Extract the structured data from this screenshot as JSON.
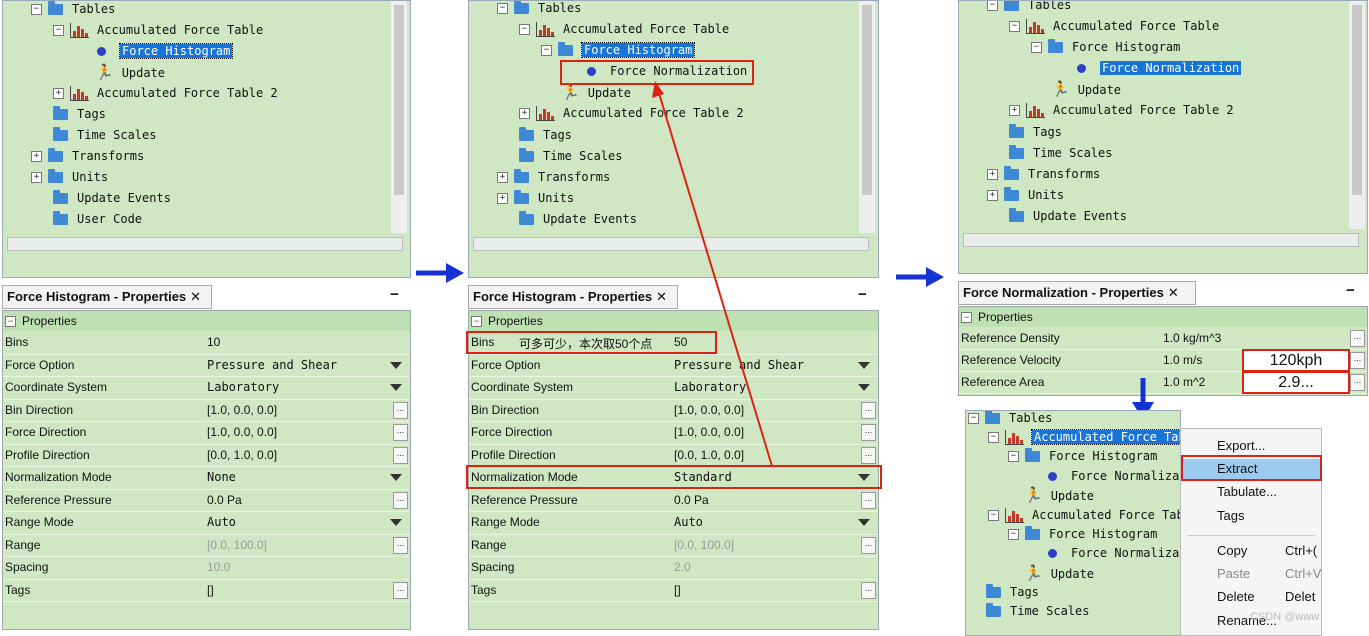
{
  "panel1": {
    "tree": [
      "Tables",
      "Accumulated Force Table",
      "Force Histogram",
      "Update",
      "Accumulated Force Table 2",
      "Tags",
      "Time Scales",
      "Transforms",
      "Units",
      "Update Events",
      "User Code"
    ],
    "title": "Force Histogram - Properties",
    "properties_header": "Properties",
    "rows": [
      {
        "k": "Bins",
        "v": "10"
      },
      {
        "k": "Force Option",
        "v": "Pressure and Shear"
      },
      {
        "k": "Coordinate System",
        "v": "Laboratory"
      },
      {
        "k": "Bin Direction",
        "v": "[1.0, 0.0, 0.0]"
      },
      {
        "k": "Force Direction",
        "v": "[1.0, 0.0, 0.0]"
      },
      {
        "k": "Profile Direction",
        "v": "[0.0, 1.0, 0.0]"
      },
      {
        "k": "Normalization Mode",
        "v": "None"
      },
      {
        "k": "Reference Pressure",
        "v": "0.0 Pa"
      },
      {
        "k": "Range Mode",
        "v": "Auto"
      },
      {
        "k": "Range",
        "v": "[0.0, 100.0]"
      },
      {
        "k": "Spacing",
        "v": "10.0"
      },
      {
        "k": "Tags",
        "v": "[]"
      }
    ]
  },
  "panel2": {
    "tree": [
      "Tables",
      "Accumulated Force Table",
      "Force Histogram",
      "Force Normalization",
      "Update",
      "Accumulated Force Table 2",
      "Tags",
      "Time Scales",
      "Transforms",
      "Units",
      "Update Events"
    ],
    "title": "Force Histogram - Properties",
    "properties_header": "Properties",
    "bins_note": "可多可少，本次取50个点",
    "rows": [
      {
        "k": "Bins",
        "v": "50"
      },
      {
        "k": "Force Option",
        "v": "Pressure and Shear"
      },
      {
        "k": "Coordinate System",
        "v": "Laboratory"
      },
      {
        "k": "Bin Direction",
        "v": "[1.0, 0.0, 0.0]"
      },
      {
        "k": "Force Direction",
        "v": "[1.0, 0.0, 0.0]"
      },
      {
        "k": "Profile Direction",
        "v": "[0.0, 1.0, 0.0]"
      },
      {
        "k": "Normalization Mode",
        "v": "Standard"
      },
      {
        "k": "Reference Pressure",
        "v": "0.0 Pa"
      },
      {
        "k": "Range Mode",
        "v": "Auto"
      },
      {
        "k": "Range",
        "v": "[0.0, 100.0]"
      },
      {
        "k": "Spacing",
        "v": "2.0"
      },
      {
        "k": "Tags",
        "v": "[]"
      }
    ]
  },
  "panel3": {
    "tree": [
      "Tables",
      "Accumulated Force Table",
      "Force Histogram",
      "Force Normalization",
      "Update",
      "Accumulated Force Table 2",
      "Tags",
      "Time Scales",
      "Transforms",
      "Units",
      "Update Events"
    ],
    "title": "Force Normalization - Properties",
    "properties_header": "Properties",
    "rows": [
      {
        "k": "Reference Density",
        "v": "1.0 kg/m^3"
      },
      {
        "k": "Reference Velocity",
        "v": "1.0 m/s"
      },
      {
        "k": "Reference Area",
        "v": "1.0 m^2"
      }
    ],
    "annot_velocity": "120kph",
    "annot_area": "2.9..."
  },
  "panel4": {
    "tree": [
      "Tables",
      "Accumulated Force Table",
      "Force Histogram",
      "Force Normalizati",
      "Update",
      "Accumulated Force Table",
      "Force Histogram",
      "Force Normalizati",
      "Update",
      "Tags",
      "Time Scales"
    ],
    "menu": [
      {
        "label": "Export...",
        "shortcut": ""
      },
      {
        "label": "Extract",
        "shortcut": ""
      },
      {
        "label": "Tabulate...",
        "shortcut": ""
      },
      {
        "label": "Tags",
        "shortcut": ""
      },
      {
        "label": "Copy",
        "shortcut": "Ctrl+("
      },
      {
        "label": "Paste",
        "shortcut": "Ctrl+V"
      },
      {
        "label": "Delete",
        "shortcut": "Delet"
      },
      {
        "label": "Rename...",
        "shortcut": ""
      }
    ],
    "watermark": "CSDN @www"
  },
  "colors": {
    "panel_bg": "#cfe8c3",
    "arrow_blue": "#1433d6",
    "highlight_red": "#d21",
    "selection": "#1874d6"
  }
}
